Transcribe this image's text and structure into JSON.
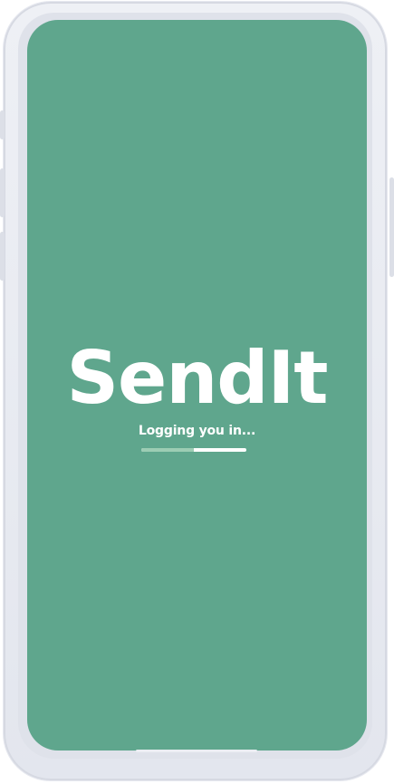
{
  "app": {
    "name": "SendIt"
  },
  "splash": {
    "status_text": "Logging you in...",
    "progress_fraction": 0.5
  },
  "colors": {
    "screen_background": "#5fa68d",
    "text": "#ffffff",
    "progress_fill": "#9ccdb4",
    "progress_track": "#ffffff"
  }
}
